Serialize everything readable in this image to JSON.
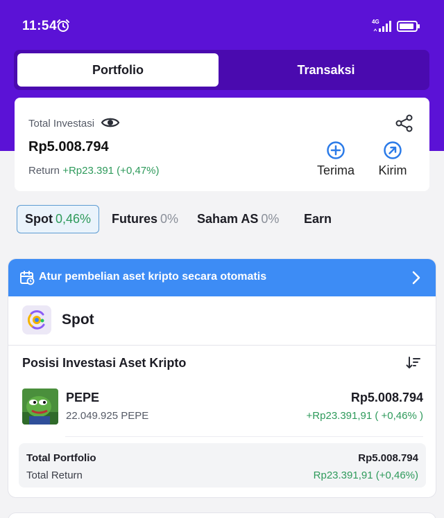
{
  "status_bar": {
    "time": "11:54",
    "network": "4G",
    "icons": [
      "alarm-icon",
      "signal-icon",
      "battery-icon"
    ]
  },
  "tabs": [
    {
      "label": "Portfolio",
      "active": true
    },
    {
      "label": "Transaksi",
      "active": false
    }
  ],
  "summary": {
    "total_label": "Total Investasi",
    "total_value": "Rp5.008.794",
    "return_label": "Return",
    "return_value": "+Rp23.391 (+0,47%)",
    "actions": [
      {
        "label": "Terima",
        "icon": "plus-circle-icon"
      },
      {
        "label": "Kirim",
        "icon": "arrow-up-right-circle-icon"
      }
    ]
  },
  "product_tabs": [
    {
      "label": "Spot",
      "pct": "0,46%",
      "active": true
    },
    {
      "label": "Futures",
      "pct": "0%",
      "active": false
    },
    {
      "label": "Saham AS",
      "pct": "0%",
      "active": false
    },
    {
      "label": "Earn",
      "pct": "",
      "active": false
    }
  ],
  "promo": {
    "text": "Atur pembelian aset kripto secara otomatis",
    "icon": "calendar-icon"
  },
  "spot": {
    "title": "Spot",
    "positions_title": "Posisi Investasi Aset Kripto",
    "assets": [
      {
        "name": "PEPE",
        "quantity": "22.049.925 PEPE",
        "value": "Rp5.008.794",
        "return": "+Rp23.391,91 ( +0,46% )"
      }
    ],
    "totals": {
      "portfolio_label": "Total Portfolio",
      "portfolio_value": "Rp5.008.794",
      "return_label": "Total Return",
      "return_value": "Rp23.391,91 (+0,46%)"
    }
  },
  "colors": {
    "brand_purple": "#5b12d6",
    "tab_track": "#4a0aaf",
    "accent_blue": "#3d8cf5",
    "positive_green": "#2e9a5b"
  }
}
